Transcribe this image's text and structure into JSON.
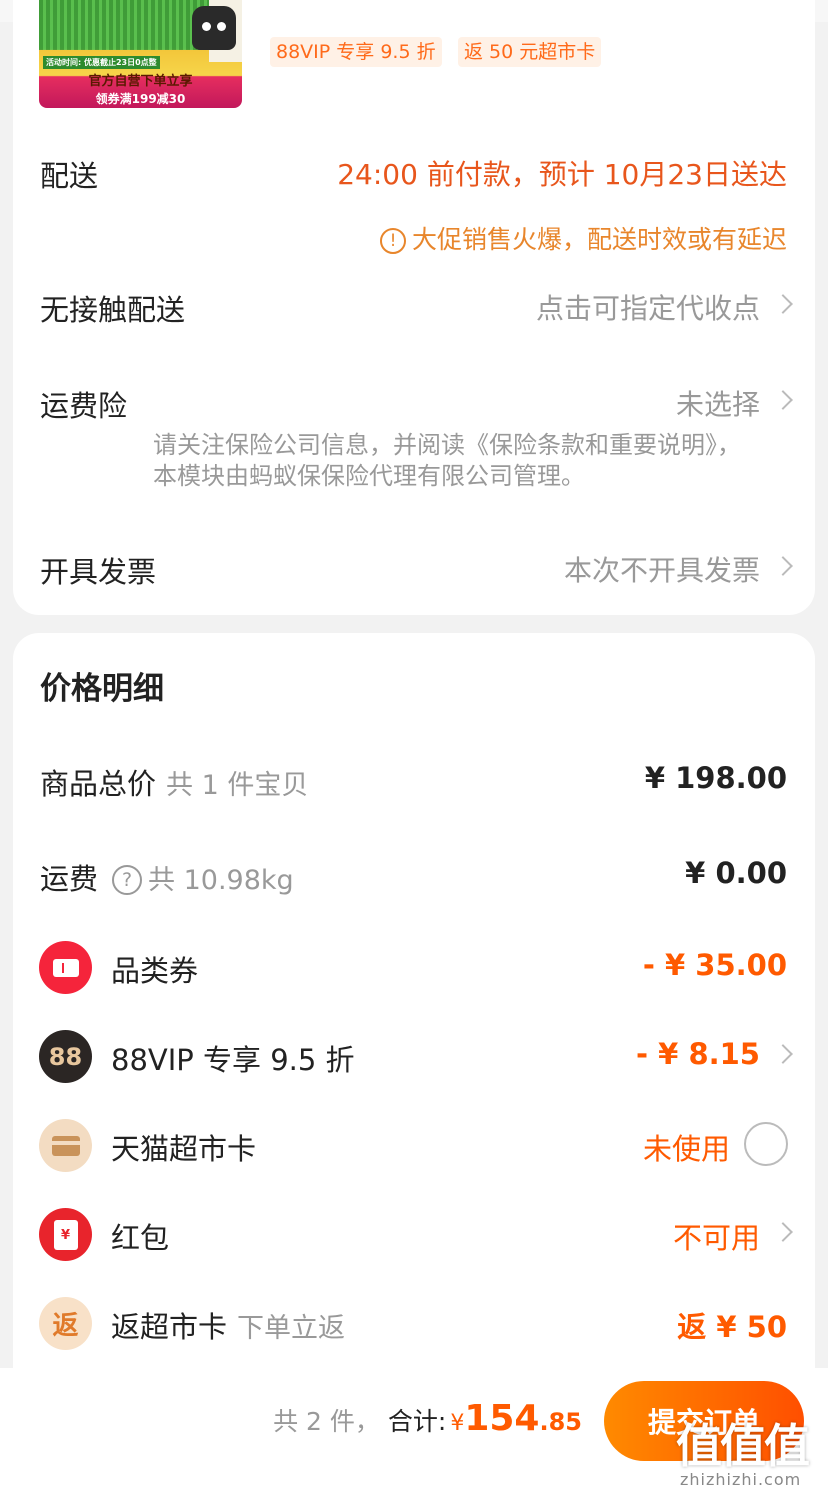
{
  "product": {
    "thumb_activity": "活动时间: 优惠截止23日0点整",
    "thumb_line1": "官方自营下单立享",
    "thumb_line2": "领券满199减30",
    "tags": [
      "88VIP 专享 9.5 折",
      "返 50 元超市卡"
    ]
  },
  "delivery": {
    "label": "配送",
    "value": "24:00 前付款，预计 10月23日送达",
    "note_icon": "!",
    "note": "大促销售火爆，配送时效或有延迟"
  },
  "contactless": {
    "label": "无接触配送",
    "value": "点击可指定代收点"
  },
  "insurance": {
    "label": "运费险",
    "value": "未选择",
    "note": "请关注保险公司信息，并阅读《保险条款和重要说明》，本模块由蚂蚁保保险代理有限公司管理。"
  },
  "invoice": {
    "label": "开具发票",
    "value": "本次不开具发票"
  },
  "price_detail": {
    "title": "价格明细",
    "goods_label": "商品总价",
    "goods_sub": "共 1 件宝贝",
    "goods_value": "¥ 198.00",
    "shipping_label": "运费",
    "shipping_icon": "?",
    "shipping_sub": "共 10.98kg",
    "shipping_value": "¥ 0.00",
    "items": [
      {
        "icon": "coupon-icon",
        "label": "品类券",
        "value": "- ¥ 35.00"
      },
      {
        "icon": "vip88-icon",
        "icon_text": "88",
        "label": "88VIP 专享 9.5 折",
        "value": "- ¥ 8.15"
      },
      {
        "icon": "supermarket-card-icon",
        "label": "天猫超市卡",
        "value": "未使用"
      },
      {
        "icon": "red-packet-icon",
        "icon_text": "¥",
        "label": "红包",
        "value": "不可用"
      },
      {
        "icon": "return-icon",
        "icon_text": "返",
        "label": "返超市卡",
        "sub": "下单立返",
        "value": "返 ¥ 50"
      }
    ]
  },
  "bottom": {
    "count": "共 2 件，",
    "total_label": "合计:",
    "yen": "¥",
    "total_int": "154",
    "total_dec": ".85",
    "submit": "提交订单"
  },
  "watermark": {
    "text": "值值值",
    "url": "zhizhizhi.com"
  },
  "colors": {
    "accent": "#ff5a00",
    "warning": "#e8862c",
    "text": "#222222",
    "muted": "#999999"
  }
}
